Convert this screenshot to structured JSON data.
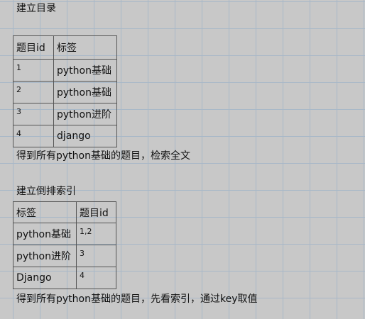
{
  "section1": {
    "title": "建立目录",
    "headers": [
      "题目id",
      "标签"
    ],
    "rows": [
      {
        "id": "1",
        "tag": "python基础"
      },
      {
        "id": "2",
        "tag": "python基础"
      },
      {
        "id": "3",
        "tag": "python进阶"
      },
      {
        "id": "4",
        "tag": "django"
      }
    ],
    "note": "得到所有python基础的题目，检索全文"
  },
  "section2": {
    "title": "建立倒排索引",
    "headers": [
      "标签",
      "题目id"
    ],
    "rows": [
      {
        "tag": "python基础",
        "ids": "1,2"
      },
      {
        "tag": "python进阶",
        "ids": "3"
      },
      {
        "tag": "Django",
        "ids": "4"
      }
    ],
    "note": "得到所有python基础的题目，先看索引，通过key取值"
  }
}
